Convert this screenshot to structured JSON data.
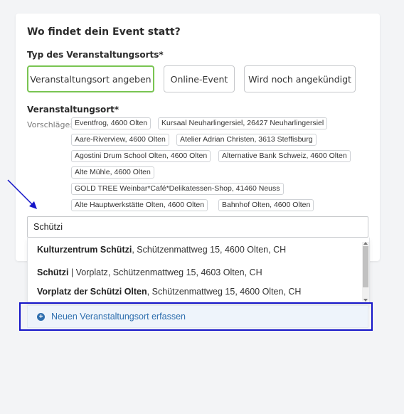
{
  "form": {
    "title": "Wo findet dein Event statt?",
    "type_label": "Typ des Veranstaltungsorts*",
    "type_options": [
      "Veranstaltungsort angeben",
      "Online-Event",
      "Wird noch angekündigt"
    ],
    "selected_type": "Veranstaltungsort angeben",
    "venue_label": "Veranstaltungsort*",
    "suggestions_label": "Vorschläge:",
    "suggestions": [
      "Eventfrog, 4600 Olten",
      "Kursaal Neuharlingersiel, 26427 Neuharlingersiel",
      "Aare-Riverview, 4600 Olten",
      "Atelier Adrian Christen, 3613 Steffisburg",
      "Agostini Drum School Olten, 4600 Olten",
      "Alternative Bank Schweiz, 4600 Olten",
      "Alte Mühle, 4600 Olten",
      "GOLD TREE Weinbar*Café*Delikatessen-Shop, 41460 Neuss",
      "Alte Hauptwerkstätte Olten, 4600 Olten",
      "Bahnhof Olten, 4600 Olten"
    ],
    "search_value": "Schützi"
  },
  "results": [
    {
      "name": "Kulturzentrum Schützi",
      "address": ", Schützenmattweg 15, 4600 Olten, CH"
    },
    {
      "name": "Schützi",
      "name_rest": " | Vorplatz",
      "address": ", Schützenmattweg 15, 4603 Olten, CH"
    },
    {
      "name": "Vorplatz der Schützi Olten",
      "address": ", Schützenmattweg 15, 4600 Olten, CH"
    }
  ],
  "new_venue_label": "Neuen Veranstaltungsort erfassen",
  "colors": {
    "active_border": "#79c452",
    "link_blue": "#2f6fae",
    "highlight_box": "#1414c8"
  }
}
